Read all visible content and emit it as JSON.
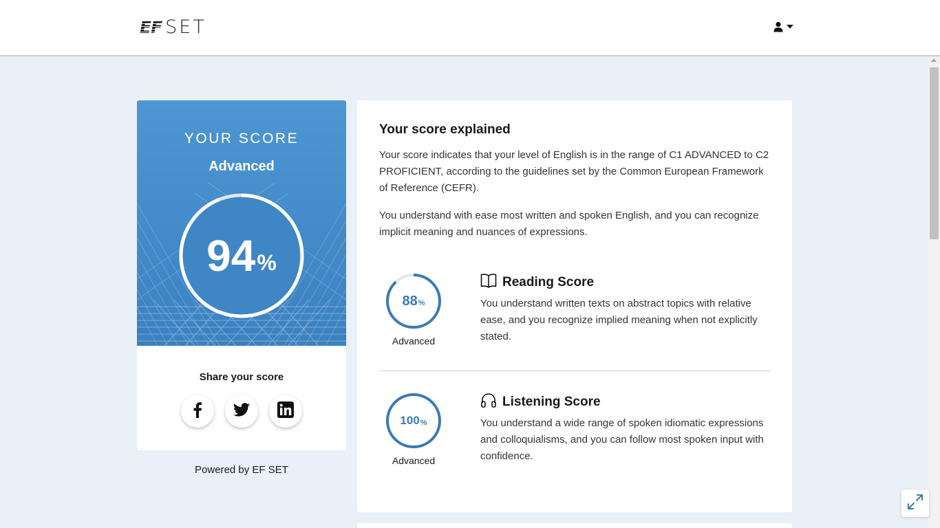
{
  "header": {
    "logo_ef": "EF",
    "logo_set": "SET",
    "user_icon": "user-icon",
    "caret_icon": "caret-down-icon"
  },
  "score_card": {
    "title": "YOUR SCORE",
    "level": "Advanced",
    "score": "94",
    "percent_sign": "%",
    "score_fraction": 0.94,
    "share_label": "Share your score",
    "share_buttons": [
      {
        "icon": "facebook-icon"
      },
      {
        "icon": "twitter-icon"
      },
      {
        "icon": "linkedin-icon"
      }
    ]
  },
  "powered_by": "Powered by EF SET",
  "explanation": {
    "title": "Your score explained",
    "paragraph1": "Your score indicates that your level of English is in the range of C1 ADVANCED to C2 PROFICIENT, according to the guidelines set by the Common European Framework of Reference (CEFR).",
    "paragraph2": "You understand with ease most written and spoken English, and you can recognize implicit meaning and nuances of expressions.",
    "skills": [
      {
        "name": "Reading Score",
        "icon": "book-icon",
        "score": "88",
        "percent_sign": "%",
        "score_fraction": 0.88,
        "level": "Advanced",
        "description": "You understand written texts on abstract topics with relative ease, and you recognize implied meaning when not explicitly stated."
      },
      {
        "name": "Listening Score",
        "icon": "headphones-icon",
        "score": "100",
        "percent_sign": "%",
        "score_fraction": 1.0,
        "level": "Advanced",
        "description": "You understand a wide range of spoken idiomatic expressions and colloquialisms, and you can follow most spoken input with confidence."
      }
    ]
  },
  "colors": {
    "page_background": "#e9f0f7",
    "hero_top": "#4d96d3",
    "hero_bottom": "#3a81c1",
    "ring_accent": "#3a7ab5",
    "ring_track": "#e2e8ee"
  },
  "expand_icon": "expand-icon"
}
